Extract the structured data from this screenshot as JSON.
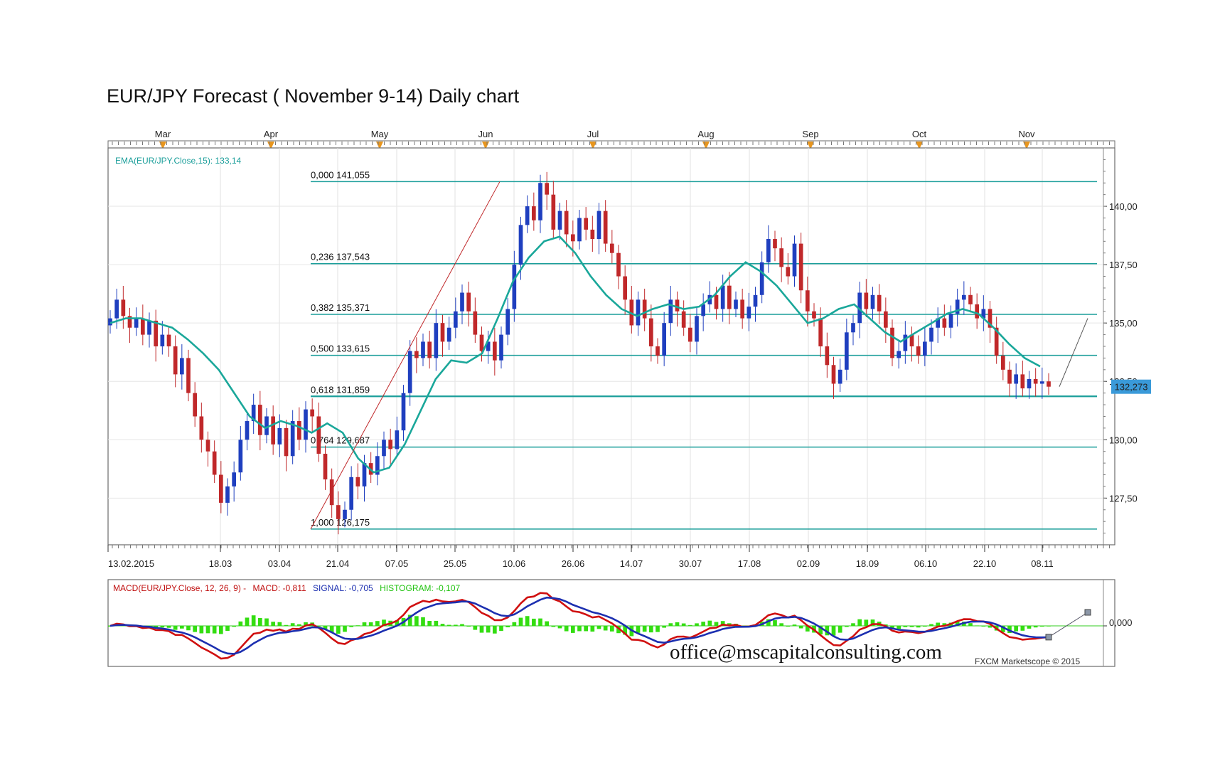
{
  "title": "EUR/JPY Forecast ( November 9-14) Daily chart",
  "chart_data": [
    {
      "type": "candlestick",
      "symbol": "EUR/JPY",
      "y_range": [
        125.5,
        142.5
      ],
      "price_ticks": [
        "140,00",
        "137,50",
        "135,00",
        "132,50",
        "130,00",
        "127,50"
      ],
      "price_tick_values": [
        140.0,
        137.5,
        135.0,
        132.5,
        130.0,
        127.5
      ],
      "month_labels": [
        "Mar",
        "Apr",
        "May",
        "Jun",
        "Jul",
        "Aug",
        "Sep",
        "Oct",
        "Nov"
      ],
      "date_labels": [
        "13.02.2015",
        "18.03",
        "03.04",
        "21.04",
        "07.05",
        "25.05",
        "10.06",
        "26.06",
        "14.07",
        "30.07",
        "17.08",
        "02.09",
        "18.09",
        "06.10",
        "22.10",
        "08.11"
      ],
      "ema_label": "EMA(EUR/JPY.Close,15): 133,14",
      "current_price_label": "132,273",
      "current_price": 132.273,
      "fibonacci_levels": [
        {
          "label": "0,000 141,055",
          "value": 141.055
        },
        {
          "label": "0,236 137,543",
          "value": 137.543
        },
        {
          "label": "0,382 135,371",
          "value": 135.371
        },
        {
          "label": "0,500 133,615",
          "value": 133.615
        },
        {
          "label": "0,618 131,859",
          "value": 131.859
        },
        {
          "label": "0,764 129,687",
          "value": 129.687
        },
        {
          "label": "1,000 126,175",
          "value": 126.175
        }
      ],
      "close_path": [
        135.2,
        136.0,
        135.3,
        134.8,
        135.2,
        134.5,
        135.1,
        134.0,
        134.5,
        134.0,
        132.8,
        133.5,
        132.0,
        131.0,
        130.0,
        129.5,
        128.5,
        127.3,
        128.0,
        128.6,
        130.0,
        130.8,
        131.5,
        130.2,
        131.0,
        129.8,
        130.5,
        129.3,
        130.8,
        130.0,
        131.3,
        131.0,
        129.4,
        128.3,
        127.2,
        126.6,
        127.0,
        128.4,
        128.0,
        129.0,
        128.5,
        129.3,
        130.0,
        129.6,
        130.4,
        132.0,
        133.8,
        133.5,
        134.2,
        133.5,
        135.0,
        134.2,
        134.8,
        135.5,
        136.3,
        135.5,
        134.5,
        133.8,
        134.2,
        133.4,
        134.5,
        135.6,
        137.5,
        139.2,
        140.0,
        139.4,
        141.0,
        140.5,
        139.0,
        139.8,
        138.8,
        138.5,
        139.5,
        139.0,
        138.6,
        139.8,
        138.4,
        138.0,
        137.0,
        136.0,
        134.9,
        136.0,
        135.2,
        134.0,
        133.6,
        135.0,
        136.0,
        135.5,
        134.8,
        134.2,
        135.3,
        135.8,
        136.2,
        135.6,
        136.6,
        135.6,
        136.0,
        135.2,
        135.7,
        136.2,
        137.6,
        138.6,
        138.2,
        137.4,
        137.0,
        138.4,
        136.4,
        135.5,
        135.2,
        134.0,
        133.2,
        132.4,
        133.0,
        134.6,
        135.0,
        136.3,
        135.6,
        136.2,
        135.5,
        134.8,
        133.5,
        133.8,
        134.5,
        134.0,
        133.6,
        134.2,
        134.8,
        135.2,
        134.8,
        135.4,
        136.0,
        136.2,
        135.8,
        135.2,
        135.6,
        134.8,
        133.6,
        133.0,
        132.4,
        132.8,
        132.2,
        132.6,
        132.4,
        132.5,
        132.273
      ],
      "ema15_path": [
        135.0,
        135.2,
        135.2,
        135.0,
        134.8,
        134.3,
        133.7,
        133.0,
        132.0,
        131.0,
        130.5,
        130.8,
        130.6,
        130.3,
        130.7,
        130.3,
        129.2,
        128.6,
        128.8,
        129.8,
        131.2,
        132.6,
        133.4,
        133.3,
        133.7,
        135.2,
        136.8,
        137.8,
        138.5,
        138.7,
        138.0,
        137.0,
        136.2,
        135.6,
        135.3,
        135.6,
        135.8,
        135.6,
        135.7,
        136.2,
        137.0,
        137.6,
        137.2,
        136.6,
        135.8,
        135.0,
        135.2,
        135.6,
        135.8,
        135.2,
        134.6,
        134.2,
        134.6,
        135.0,
        135.4,
        135.6,
        135.4,
        134.8,
        134.1,
        133.5,
        133.14
      ],
      "macd": {
        "label": "MACD(EUR/JPY.Close, 12, 26, 9) -",
        "macd_label": "MACD: -0,811",
        "signal_label": "SIGNAL: -0,705",
        "histogram_label": "HISTOGRAM: -0,107",
        "zero_label": "0,000",
        "macd_value": -0.811,
        "signal_value": -0.705,
        "histogram_value": -0.107
      }
    }
  ],
  "watermark": "office@mscapitalconsulting.com",
  "footer_credit": "FXCM Marketscope © 2015",
  "colors": {
    "up_candle": "#1f3fbf",
    "down_candle": "#c0282a",
    "ema": "#1aa79a",
    "fib_line": "#1a9e9a",
    "macd_line": "#d01010",
    "signal_line": "#1c2fb0",
    "histogram": "#33dd11",
    "price_box": "#3a9ad9",
    "month_marker": "#e8961e"
  }
}
